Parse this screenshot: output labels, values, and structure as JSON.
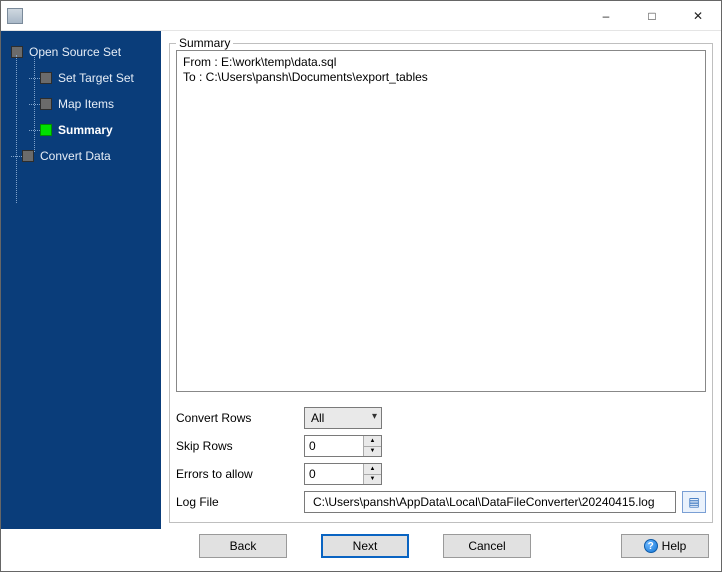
{
  "window": {
    "title": ""
  },
  "sidebar": {
    "items": [
      {
        "label": "Open Source Set"
      },
      {
        "label": "Set Target Set"
      },
      {
        "label": "Map Items"
      },
      {
        "label": "Summary"
      },
      {
        "label": "Convert Data"
      }
    ]
  },
  "groupbox": {
    "title": "Summary"
  },
  "summary_lines": "From : E:\\work\\temp\\data.sql\nTo : C:\\Users\\pansh\\Documents\\export_tables",
  "form": {
    "convert_rows": {
      "label": "Convert Rows",
      "value": "All"
    },
    "skip_rows": {
      "label": "Skip Rows",
      "value": "0"
    },
    "errors": {
      "label": "Errors to allow",
      "value": "0"
    },
    "log_file": {
      "label": "Log File",
      "value": "C:\\Users\\pansh\\AppData\\Local\\DataFileConverter\\20240415.log"
    }
  },
  "buttons": {
    "back": "Back",
    "next": "Next",
    "cancel": "Cancel",
    "help": "Help"
  }
}
